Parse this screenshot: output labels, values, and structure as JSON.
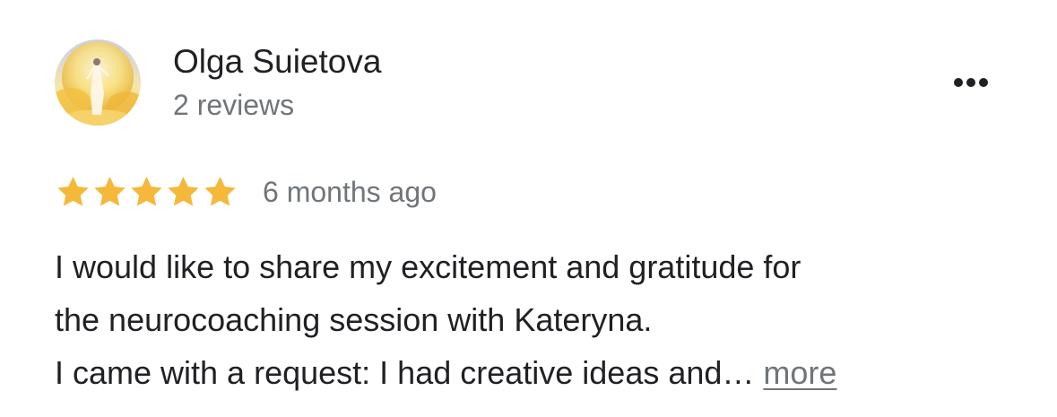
{
  "review": {
    "author_name": "Olga Suietova",
    "review_count": "2 reviews",
    "avatar_icon": "avatar-photo",
    "more_options_icon": "more-horizontal-icon",
    "rating": 5,
    "rating_max": 5,
    "time_ago": "6 months ago",
    "text_lines": [
      "I would like to share my excitement and gratitude for",
      "the neurocoaching session with Kateryna.",
      "I came with a request: I had creative ideas and…"
    ],
    "more_label": "more"
  },
  "colors": {
    "star": "#f4b93a",
    "name_text": "#202124",
    "secondary_text": "#70757a",
    "background": "#ffffff"
  }
}
